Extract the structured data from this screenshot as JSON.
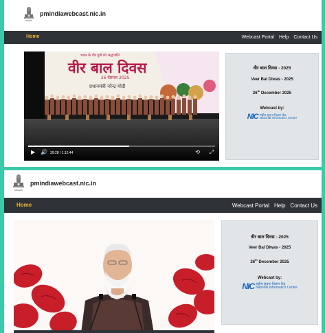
{
  "site": {
    "title": "pmindiawebcast.nic.in",
    "emblem_caption": "सत्यमेव जयते"
  },
  "nav": {
    "home": "Home",
    "right": [
      "Webcast Portal",
      "Help",
      "Contact Us"
    ]
  },
  "event": {
    "title_hi": "वीर बाल दिवस - 2025",
    "title_en": "Veer Bal Diwas - 2025",
    "date_day": "26",
    "date_suffix": "th",
    "date_rest": " December 2025",
    "webcast_by": "Webcast by:",
    "nic_logo": "NIC",
    "nic_hi": "राष्ट्रीय सूचना विज्ञान केंद्र",
    "nic_en": "National Informatics Centre"
  },
  "video1": {
    "banner_top": "भारत के वीर पुत्रों को श्रद्धांजलि",
    "banner_title": "वीर बाल दिवस",
    "banner_date": "26 दिसंबर 2025",
    "banner_sub": "प्रधानमंत्री नरेन्द्र मोदी",
    "time": "39:28 / 1:12:44",
    "progress": 0.54
  },
  "colors": {
    "accent": "#f0b23a",
    "nav_bg": "#2f3236",
    "frame_bg": "#3cc9a8",
    "nic_blue": "#1565c0"
  }
}
